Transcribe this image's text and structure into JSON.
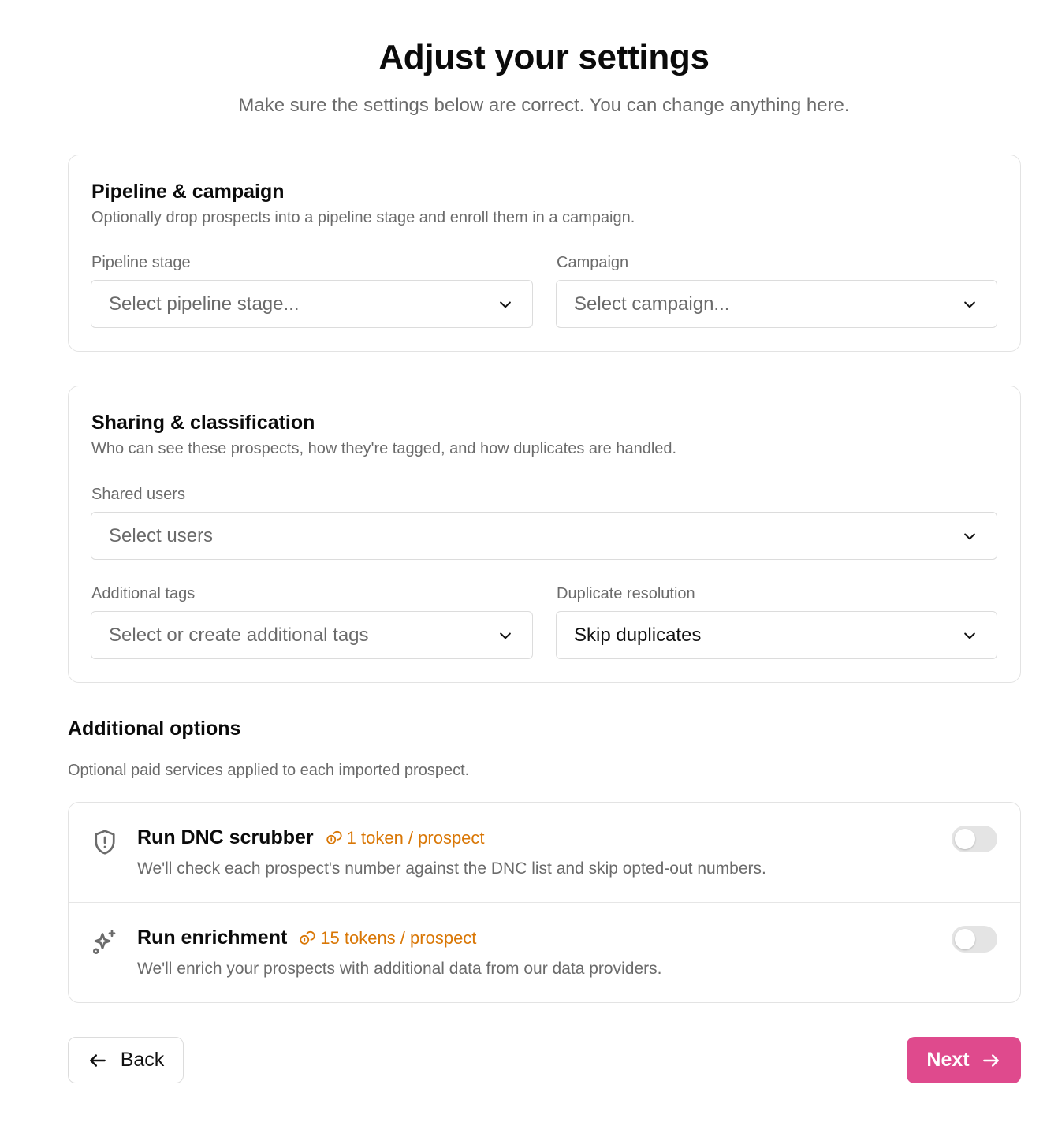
{
  "header": {
    "title": "Adjust your settings",
    "subtitle": "Make sure the settings below are correct. You can change anything here."
  },
  "pipeline_card": {
    "title": "Pipeline & campaign",
    "description": "Optionally drop prospects into a pipeline stage and enroll them in a campaign.",
    "pipeline_stage": {
      "label": "Pipeline stage",
      "placeholder": "Select pipeline stage..."
    },
    "campaign": {
      "label": "Campaign",
      "placeholder": "Select campaign..."
    }
  },
  "sharing_card": {
    "title": "Sharing & classification",
    "description": "Who can see these prospects, how they're tagged, and how duplicates are handled.",
    "shared_users": {
      "label": "Shared users",
      "placeholder": "Select users"
    },
    "additional_tags": {
      "label": "Additional tags",
      "placeholder": "Select or create additional tags"
    },
    "duplicate_resolution": {
      "label": "Duplicate resolution",
      "value": "Skip duplicates"
    }
  },
  "additional_options": {
    "title": "Additional options",
    "description": "Optional paid services applied to each imported prospect.",
    "items": [
      {
        "icon": "shield-alert-icon",
        "title": "Run DNC scrubber",
        "cost": "1 token / prospect",
        "description": "We'll check each prospect's number against the DNC list and skip opted-out numbers.",
        "enabled": false
      },
      {
        "icon": "sparkles-icon",
        "title": "Run enrichment",
        "cost": "15 tokens / prospect",
        "description": "We'll enrich your prospects with additional data from our data providers.",
        "enabled": false
      }
    ]
  },
  "footer": {
    "back_label": "Back",
    "next_label": "Next"
  },
  "colors": {
    "accent": "#df4a8d",
    "token_cost": "#d97706",
    "toggle_off": "#e4e4e4"
  }
}
